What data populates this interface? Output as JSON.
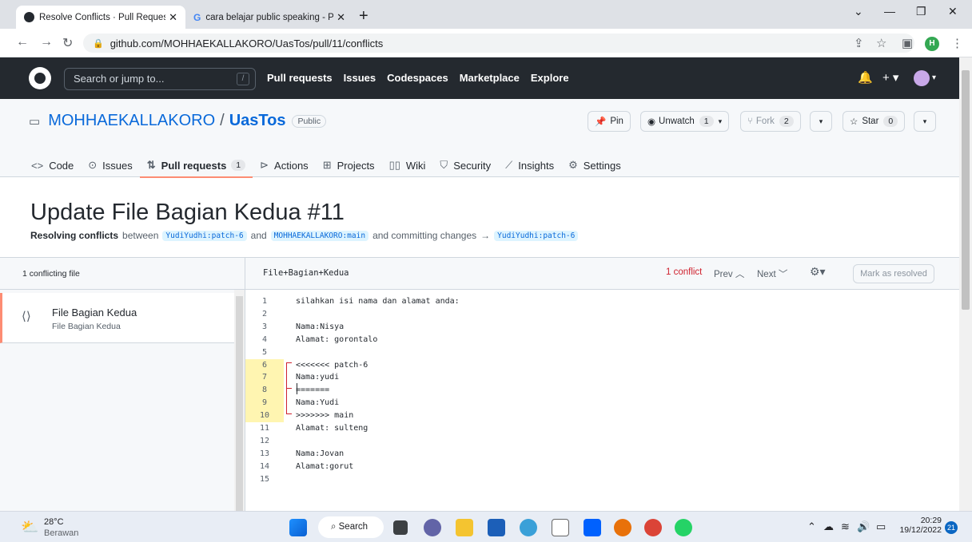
{
  "browser": {
    "tabs": [
      {
        "title": "Resolve Conflicts · Pull Request #",
        "active": true
      },
      {
        "title": "cara belajar public speaking - Pe",
        "active": false
      }
    ],
    "url": "github.com/MOHHAEKALLAKORO/UasTos/pull/11/conflicts",
    "profile_initial": "H"
  },
  "github": {
    "search_placeholder": "Search or jump to...",
    "search_key": "/",
    "nav": [
      "Pull requests",
      "Issues",
      "Codespaces",
      "Marketplace",
      "Explore"
    ]
  },
  "repo": {
    "owner": "MOHHAEKALLAKORO",
    "separator": "/",
    "name": "UasTos",
    "visibility": "Public",
    "pin_label": "Pin",
    "unwatch_label": "Unwatch",
    "unwatch_count": "1",
    "fork_label": "Fork",
    "fork_count": "2",
    "star_label": "Star",
    "star_count": "0",
    "tabs": [
      {
        "label": "Code",
        "icon": "code-icon"
      },
      {
        "label": "Issues",
        "icon": "issue-icon"
      },
      {
        "label": "Pull requests",
        "icon": "pull-request-icon",
        "count": "1",
        "selected": true
      },
      {
        "label": "Actions",
        "icon": "play-icon"
      },
      {
        "label": "Projects",
        "icon": "table-icon"
      },
      {
        "label": "Wiki",
        "icon": "book-icon"
      },
      {
        "label": "Security",
        "icon": "shield-icon"
      },
      {
        "label": "Insights",
        "icon": "graph-icon"
      },
      {
        "label": "Settings",
        "icon": "gear-icon"
      }
    ]
  },
  "pr": {
    "title": "Update File Bagian Kedua #11",
    "resolving": "Resolving conflicts",
    "between": "between",
    "head_branch": "YudiYudhi:patch-6",
    "and": "and",
    "base_branch": "MOHHAEKALLAKORO:main",
    "committing": "and committing changes",
    "arrow": "→",
    "target_branch": "YudiYudhi:patch-6"
  },
  "conflicts": {
    "files_header": "1 conflicting file",
    "file_name": "File Bagian Kedua",
    "file_path": "File Bagian Kedua",
    "editor_filename": "File+Bagian+Kedua",
    "conflict_count": "1 conflict",
    "prev_label": "Prev",
    "next_label": "Next",
    "mark_resolved_label": "Mark as resolved",
    "lines": [
      {
        "n": "1",
        "text": "silahkan isi nama dan alamat anda:",
        "conflict": false
      },
      {
        "n": "2",
        "text": "",
        "conflict": false
      },
      {
        "n": "3",
        "text": "Nama:Nisya",
        "conflict": false
      },
      {
        "n": "4",
        "text": "Alamat: gorontalo",
        "conflict": false
      },
      {
        "n": "5",
        "text": "",
        "conflict": false
      },
      {
        "n": "6",
        "text": "<<<<<<< patch-6",
        "conflict": true
      },
      {
        "n": "7",
        "text": "Nama:yudi",
        "conflict": true
      },
      {
        "n": "8",
        "text": "=======",
        "conflict": true
      },
      {
        "n": "9",
        "text": "Nama:Yudi",
        "conflict": true
      },
      {
        "n": "10",
        "text": ">>>>>>> main",
        "conflict": true
      },
      {
        "n": "11",
        "text": "Alamat: sulteng",
        "conflict": false
      },
      {
        "n": "12",
        "text": "",
        "conflict": false
      },
      {
        "n": "13",
        "text": "Nama:Jovan",
        "conflict": false
      },
      {
        "n": "14",
        "text": "Alamat:gorut",
        "conflict": false
      },
      {
        "n": "15",
        "text": "",
        "conflict": false
      }
    ]
  },
  "taskbar": {
    "temperature": "28°C",
    "condition": "Berawan",
    "search_label": "Search",
    "time": "20:29",
    "date": "19/12/2022",
    "notifications": "21"
  },
  "colors": {
    "github_header": "#24292f",
    "link": "#0969da",
    "conflict_red": "#cf222e",
    "conflict_highlight": "#fff5b1",
    "selected_tab_underline": "#fd8c73"
  }
}
